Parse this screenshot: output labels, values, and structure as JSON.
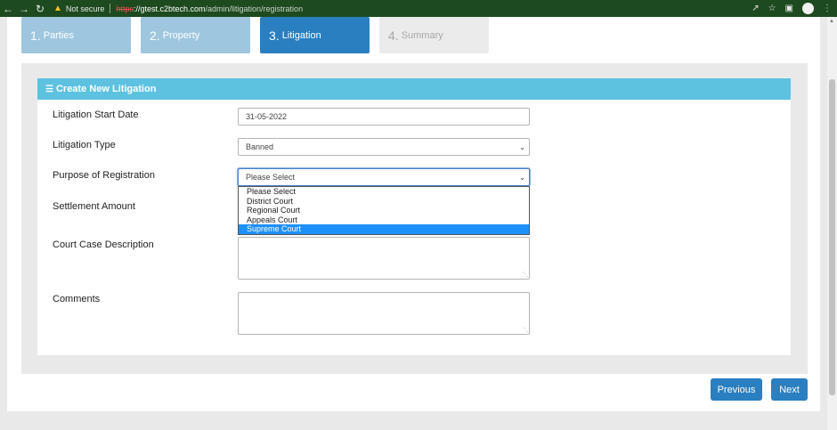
{
  "browser": {
    "security_label": "Not secure",
    "url_scheme": "https",
    "url_scheme_suffix": "://",
    "url_host": "gtest.c2btech.com",
    "url_path": "/admin/litigation/registration"
  },
  "steps": [
    {
      "num": "1.",
      "label": "Parties"
    },
    {
      "num": "2.",
      "label": "Property"
    },
    {
      "num": "3.",
      "label": "Litigation"
    },
    {
      "num": "4.",
      "label": "Summary"
    }
  ],
  "form": {
    "title": "Create New Litigation",
    "start_date_label": "Litigation Start Date",
    "start_date_value": "31-05-2022",
    "type_label": "Litigation Type",
    "type_value": "Banned",
    "purpose_label": "Purpose of Registration",
    "purpose_value": "Please Select",
    "settlement_label": "Settlement Amount",
    "description_label": "Court Case Description",
    "comments_label": "Comments"
  },
  "purpose_options": [
    "Please Select",
    "District Court",
    "Regional Court",
    "Appeals Court",
    "Supreme Court"
  ],
  "purpose_highlighted": "Supreme Court",
  "buttons": {
    "previous": "Previous",
    "next": "Next"
  },
  "colors": {
    "step_active": "#2a7fc0",
    "step_done": "#9ec7df",
    "step_pending": "#ebebeb",
    "card_header": "#5dc1e0",
    "button": "#2a7fc0",
    "dropdown_highlight": "#1e90ff"
  }
}
